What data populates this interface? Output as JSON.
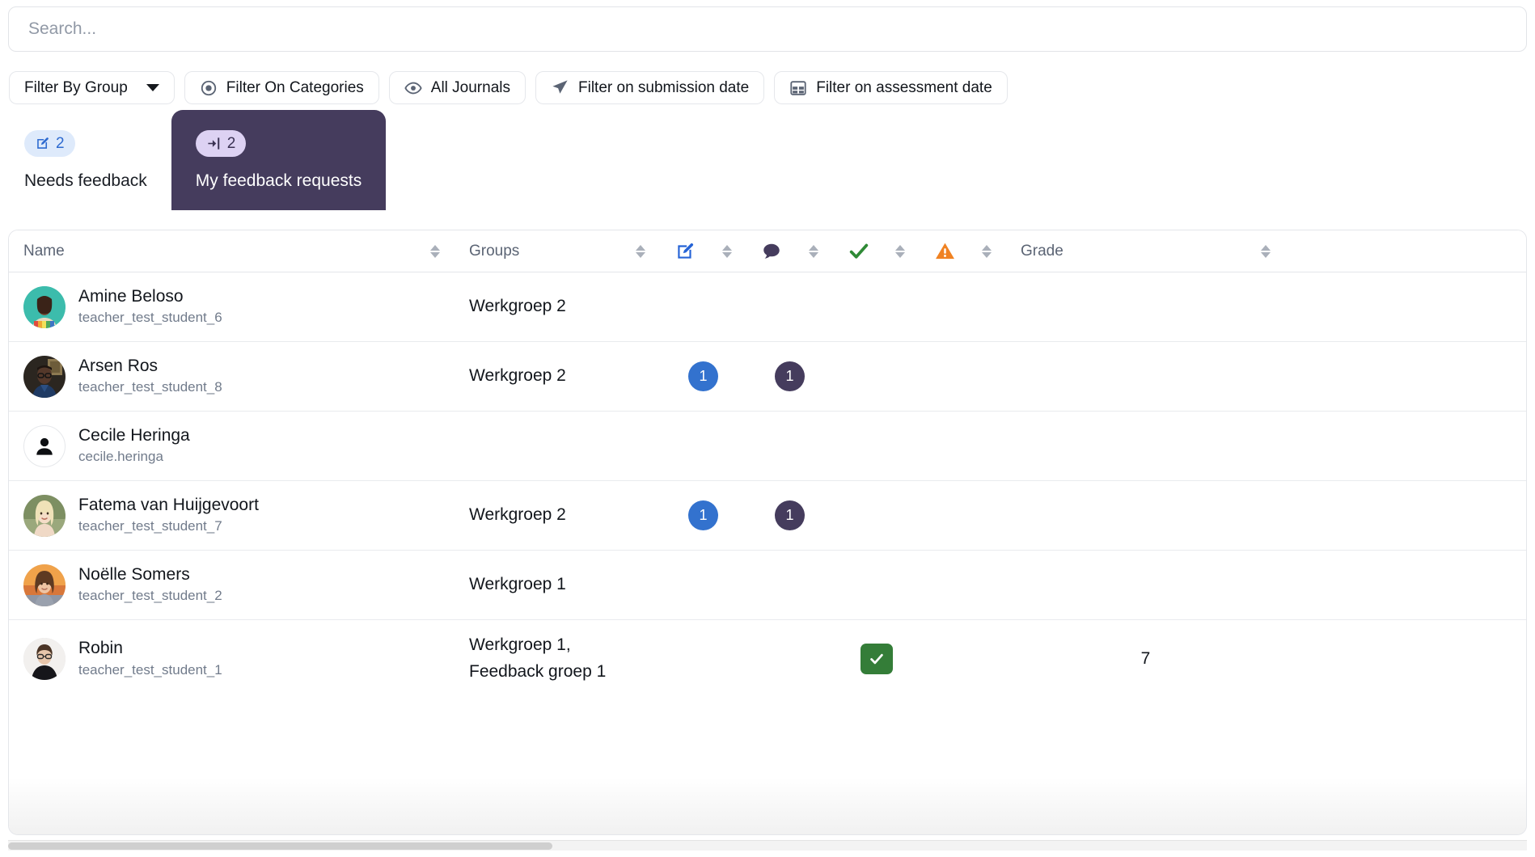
{
  "search": {
    "placeholder": "Search...",
    "value": ""
  },
  "filters": [
    {
      "name": "filter-by-group",
      "label": "Filter By Group",
      "icon": "chevron-down-icon",
      "has_caret": true
    },
    {
      "name": "filter-on-categories",
      "label": "Filter On Categories",
      "icon": "target-icon",
      "has_caret": false
    },
    {
      "name": "all-journals",
      "label": "All Journals",
      "icon": "eye-icon",
      "has_caret": false
    },
    {
      "name": "filter-on-submission-date",
      "label": "Filter on submission date",
      "icon": "paper-plane-icon",
      "has_caret": false
    },
    {
      "name": "filter-on-assessment-date",
      "label": "Filter on assessment date",
      "icon": "table-icon",
      "has_caret": false
    }
  ],
  "tabs": [
    {
      "name": "needs-feedback",
      "label": "Needs feedback",
      "count": "2",
      "icon": "pen-square-icon",
      "active": false
    },
    {
      "name": "my-feedback-requests",
      "label": "My feedback requests",
      "count": "2",
      "icon": "arrow-into-bracket-icon",
      "active": true
    }
  ],
  "table": {
    "columns": [
      {
        "key": "name",
        "label": "Name",
        "icon": null,
        "sortable": true
      },
      {
        "key": "groups",
        "label": "Groups",
        "icon": null,
        "sortable": true
      },
      {
        "key": "edits",
        "label": "",
        "icon": "pen-square-icon",
        "sortable": true
      },
      {
        "key": "comments",
        "label": "",
        "icon": "comment-icon",
        "sortable": true
      },
      {
        "key": "done",
        "label": "",
        "icon": "check-icon",
        "sortable": true
      },
      {
        "key": "warning",
        "label": "",
        "icon": "warning-icon",
        "sortable": true
      },
      {
        "key": "grade",
        "label": "Grade",
        "icon": null,
        "sortable": true
      }
    ],
    "rows": [
      {
        "name": "Amine Beloso",
        "username": "teacher_test_student_6",
        "avatar": "photo",
        "groups": "Werkgroep 2",
        "edits": "",
        "comments": "",
        "done": false,
        "warning": "",
        "grade": ""
      },
      {
        "name": "Arsen Ros",
        "username": "teacher_test_student_8",
        "avatar": "photo",
        "groups": "Werkgroep 2",
        "edits": "1",
        "comments": "1",
        "done": false,
        "warning": "",
        "grade": ""
      },
      {
        "name": "Cecile Heringa",
        "username": "cecile.heringa",
        "avatar": "placeholder",
        "groups": "",
        "edits": "",
        "comments": "",
        "done": false,
        "warning": "",
        "grade": ""
      },
      {
        "name": "Fatema van Huijgevoort",
        "username": "teacher_test_student_7",
        "avatar": "photo",
        "groups": "Werkgroep 2",
        "edits": "1",
        "comments": "1",
        "done": false,
        "warning": "",
        "grade": ""
      },
      {
        "name": "Noëlle Somers",
        "username": "teacher_test_student_2",
        "avatar": "photo",
        "groups": "Werkgroep 1",
        "edits": "",
        "comments": "",
        "done": false,
        "warning": "",
        "grade": ""
      },
      {
        "name": "Robin",
        "username": "teacher_test_student_1",
        "avatar": "photo",
        "groups": "Werkgroep 1, Feedback groep 1",
        "edits": "",
        "comments": "",
        "done": true,
        "warning": "",
        "grade": "7"
      }
    ]
  },
  "colors": {
    "accent_plum": "#453c5d",
    "badge_blue_bg": "#deeafb",
    "badge_blue_text": "#2d6ad0",
    "badge_lilac_bg": "#ddd2f3",
    "pill_blue": "#3372ce",
    "pill_plum": "#453c5d",
    "check_green": "#347d38",
    "warning_orange": "#f08222",
    "edit_blue": "#2563d6"
  }
}
